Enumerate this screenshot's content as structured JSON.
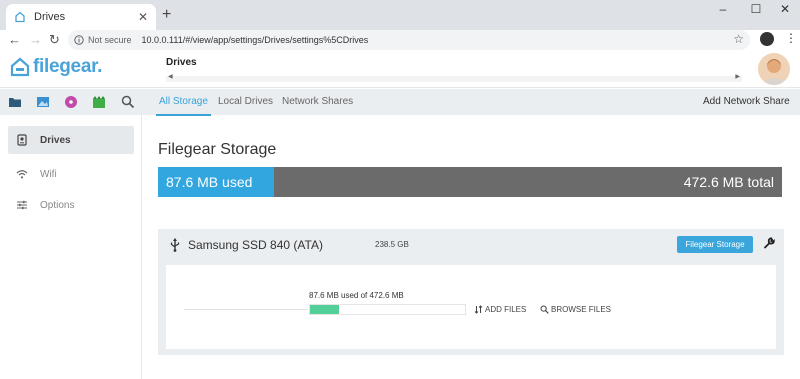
{
  "browser": {
    "tab_title": "Drives",
    "new_tab": "+",
    "close_tab": "✕",
    "minimize": "–",
    "maximize": "☐",
    "close_window": "✕",
    "url_security": "Not secure",
    "url": "10.0.0.111/#/view/app/settings/Drives/settings%5CDrives"
  },
  "app": {
    "logo_text": "filegear.",
    "page_title": "Drives"
  },
  "tabs": [
    {
      "label": "All Storage",
      "active": true
    },
    {
      "label": "Local Drives",
      "active": false
    },
    {
      "label": "Network Shares",
      "active": false
    }
  ],
  "add_network_share": "Add Network Share",
  "sidebar": {
    "items": [
      {
        "label": "Drives",
        "icon": "drive-icon",
        "active": true
      },
      {
        "label": "Wifi",
        "icon": "wifi-icon",
        "active": false
      },
      {
        "label": "Options",
        "icon": "sliders-icon",
        "active": false
      }
    ]
  },
  "storage": {
    "title": "Filegear Storage",
    "used_label": "87.6 MB used",
    "total_label": "472.6 MB total",
    "used_fraction": 0.1853
  },
  "drive": {
    "name": "Samsung SSD 840 (ATA)",
    "size": "238.5 GB",
    "storage_button": "Filegear Storage",
    "usage_text": "87.6 MB used of 472.6 MB",
    "used_fraction": 0.1853,
    "add_files": "ADD FILES",
    "browse_files": "BROWSE FILES"
  },
  "colors": {
    "accent": "#38a2d9",
    "bar_used": "#32a6de",
    "bar_remaining": "#6b6b6b",
    "drive_fill": "#52d097"
  }
}
